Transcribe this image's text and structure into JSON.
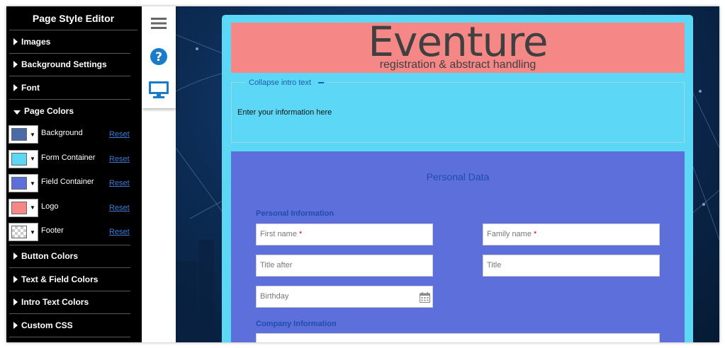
{
  "sidebar": {
    "title": "Page Style Editor",
    "sections_top": [
      {
        "label": "Images"
      },
      {
        "label": "Background Settings"
      },
      {
        "label": "Font"
      }
    ],
    "page_colors": {
      "label": "Page Colors",
      "reset_label": "Reset",
      "items": [
        {
          "label": "Background",
          "color": "#4a6aa8"
        },
        {
          "label": "Form Container",
          "color": "#5dd7f6"
        },
        {
          "label": "Field Container",
          "color": "#5d6fdb"
        },
        {
          "label": "Logo",
          "color": "#f58786"
        },
        {
          "label": "Footer",
          "color": "transparent"
        }
      ]
    },
    "sections_bottom": [
      {
        "label": "Button Colors"
      },
      {
        "label": "Text & Field Colors"
      },
      {
        "label": "Intro Text Colors"
      },
      {
        "label": "Custom CSS"
      }
    ]
  },
  "iconbar": {
    "icons": [
      "menu-icon",
      "help-icon",
      "desktop-icon"
    ]
  },
  "logo": {
    "title": "Eventure",
    "subtitle": "registration & abstract handling"
  },
  "intro": {
    "collapse_label": "Collapse intro text",
    "text": "Enter your information here"
  },
  "form": {
    "section_title": "Personal Data",
    "personal_info_label": "Personal Information",
    "first_name_placeholder": "First name",
    "family_name_placeholder": "Family name",
    "required_mark": "*",
    "title_after_placeholder": "Title after",
    "title_placeholder": "Title",
    "birthday_placeholder": "Birthday",
    "company_info_label": "Company Information"
  },
  "colors": {
    "sidebar_bg": "#000000",
    "form_container": "#5dd7f6",
    "field_container": "#5d6fdb",
    "logo_bg": "#f58786",
    "accent_blue": "#1e5da8",
    "link_blue": "#3a7bd5"
  }
}
